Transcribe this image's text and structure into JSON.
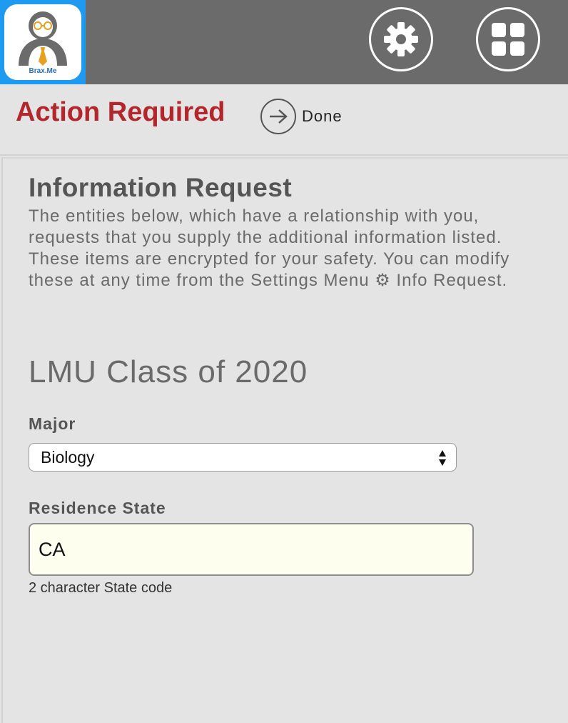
{
  "topbar": {
    "logo_text": "Brax.Me",
    "settings_icon": "gear-icon",
    "apps_icon": "grid-icon",
    "bg_color": "#6b6b6b",
    "logo_color": "#1e9bf0"
  },
  "header": {
    "title": "Action Required",
    "done_label": "Done",
    "title_color": "#b3262b"
  },
  "content": {
    "info_title": "Information Request",
    "info_text": "The entities below, which have a relationship with you, requests that you supply the additional information listed. These items are encrypted for your safety. You can modify these at any time from the Settings Menu ⚙ Info Request.",
    "group_title": "LMU Class of 2020",
    "major_label": "Major",
    "major_value": "Biology",
    "state_label": "Residence State",
    "state_value": "CA",
    "state_hint": "2 character State code"
  }
}
